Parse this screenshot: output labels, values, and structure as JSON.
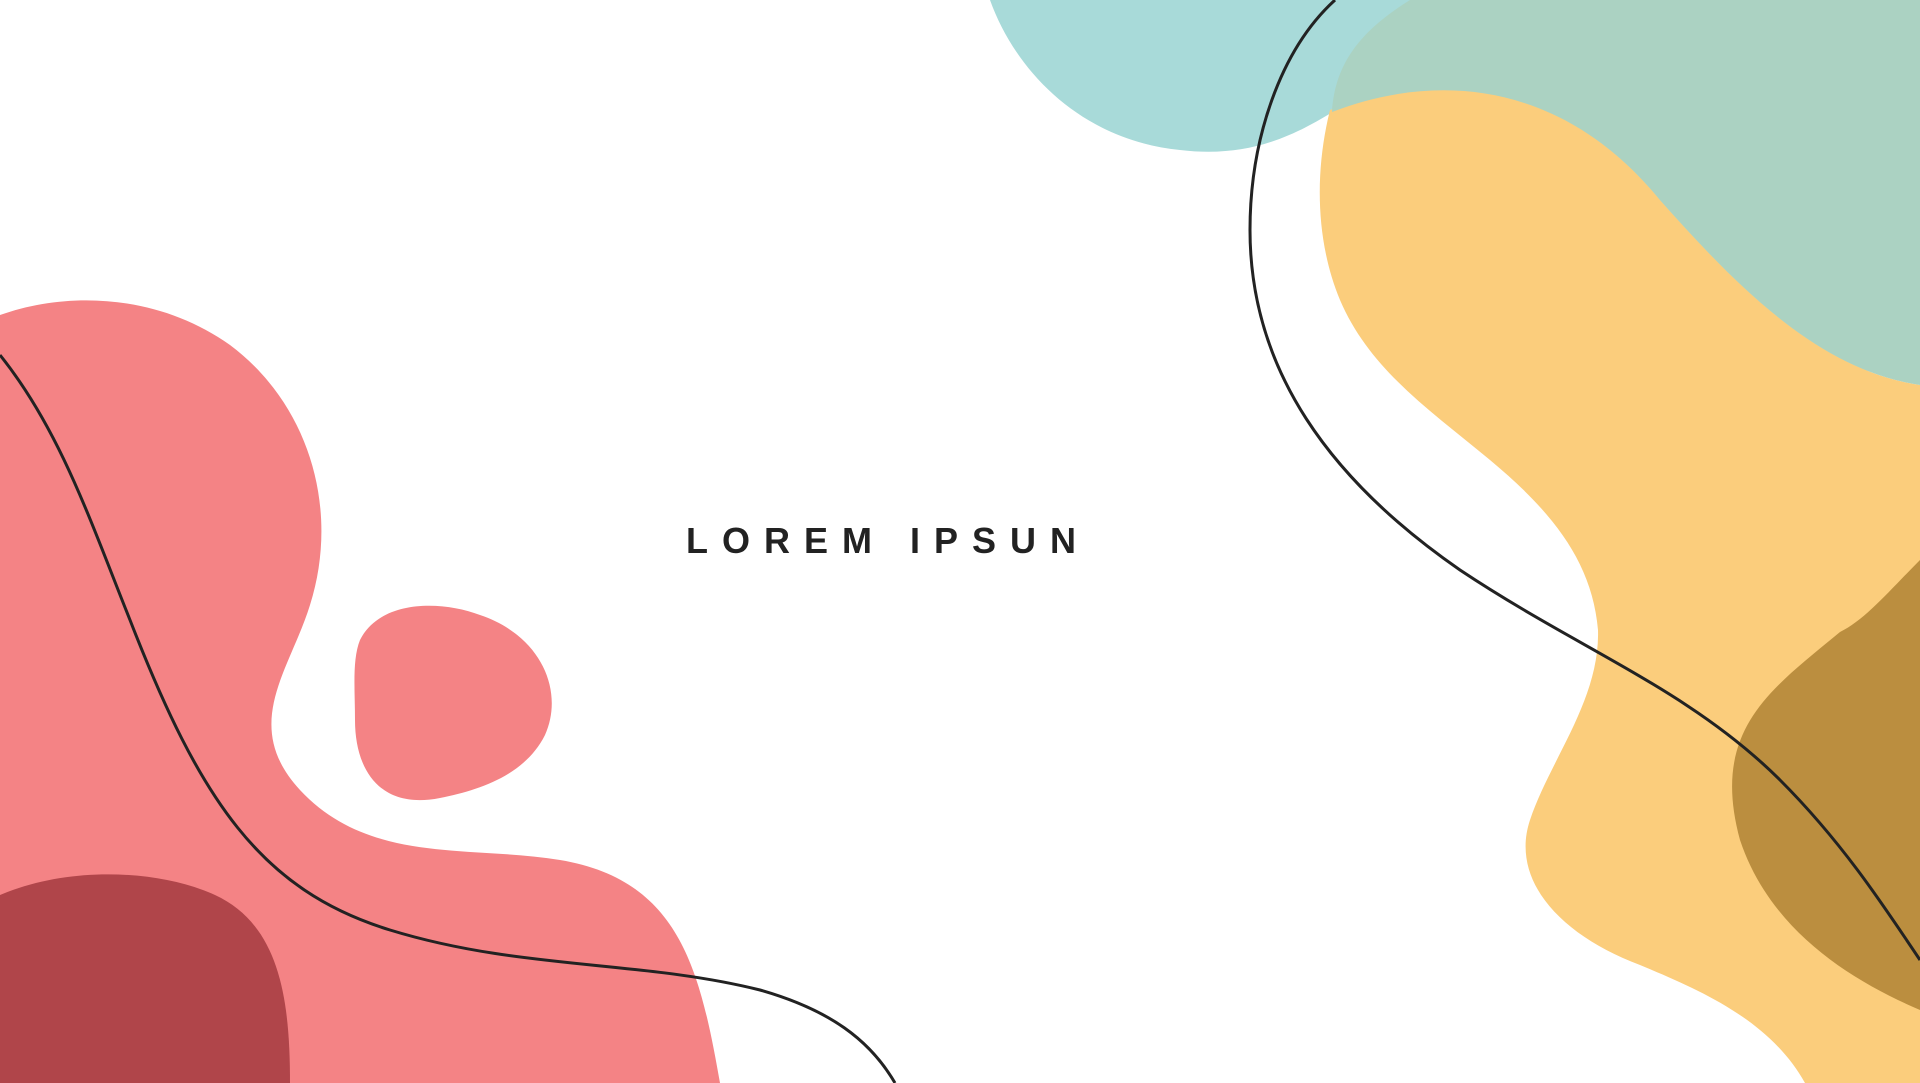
{
  "headline": "LOREM IPSUN",
  "colors": {
    "background": "#ffffff",
    "teal": "#a8dad9",
    "teal_overlap": "#abd2c2",
    "yellow": "#fbcd7c",
    "ochre": "#bb8e3f",
    "coral": "#f48385",
    "maroon": "#b0454a",
    "line": "#222222"
  }
}
